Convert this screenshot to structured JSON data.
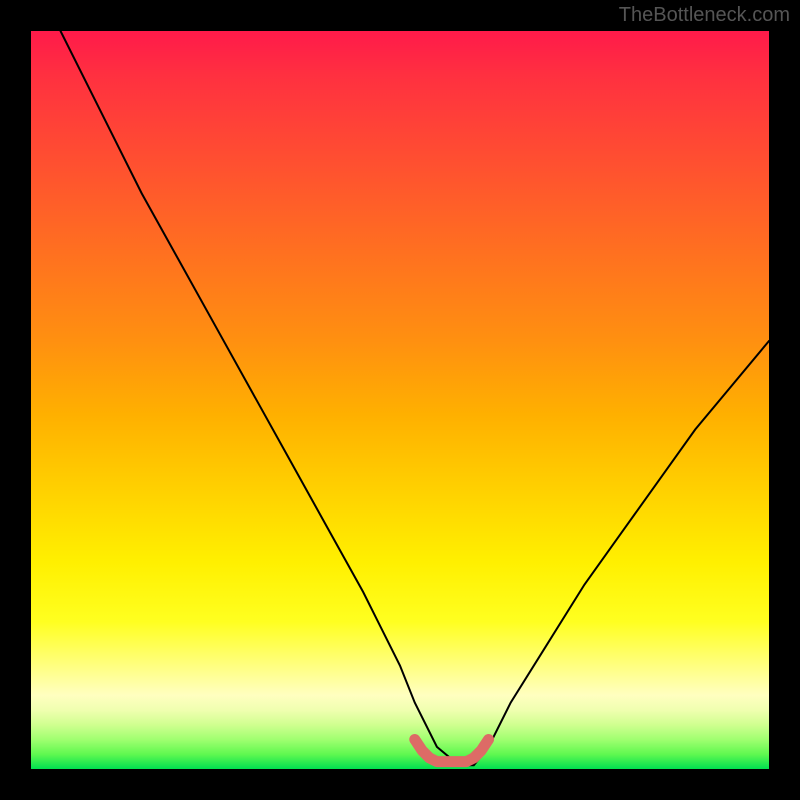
{
  "watermark": "TheBottleneck.com",
  "chart_data": {
    "type": "line",
    "title": "",
    "xlabel": "",
    "ylabel": "",
    "xlim": [
      0,
      100
    ],
    "ylim": [
      0,
      100
    ],
    "series": [
      {
        "name": "bottleneck-curve",
        "x": [
          4,
          10,
          15,
          20,
          25,
          30,
          35,
          40,
          45,
          50,
          52,
          55,
          58,
          60,
          62,
          65,
          70,
          75,
          80,
          85,
          90,
          95,
          100
        ],
        "values": [
          100,
          88,
          78,
          69,
          60,
          51,
          42,
          33,
          24,
          14,
          9,
          3,
          0.5,
          0.5,
          3,
          9,
          17,
          25,
          32,
          39,
          46,
          52,
          58
        ]
      },
      {
        "name": "optimal-marker",
        "x": [
          52,
          53,
          54,
          55,
          56,
          57,
          58,
          59,
          60,
          61,
          62
        ],
        "values": [
          4,
          2.5,
          1.5,
          1,
          1,
          1,
          1,
          1,
          1.5,
          2.5,
          4
        ]
      }
    ],
    "gradient_stops": [
      {
        "pct": 0,
        "color": "#ff1a4a"
      },
      {
        "pct": 50,
        "color": "#ffc000"
      },
      {
        "pct": 85,
        "color": "#ffff80"
      },
      {
        "pct": 100,
        "color": "#00e050"
      }
    ]
  }
}
